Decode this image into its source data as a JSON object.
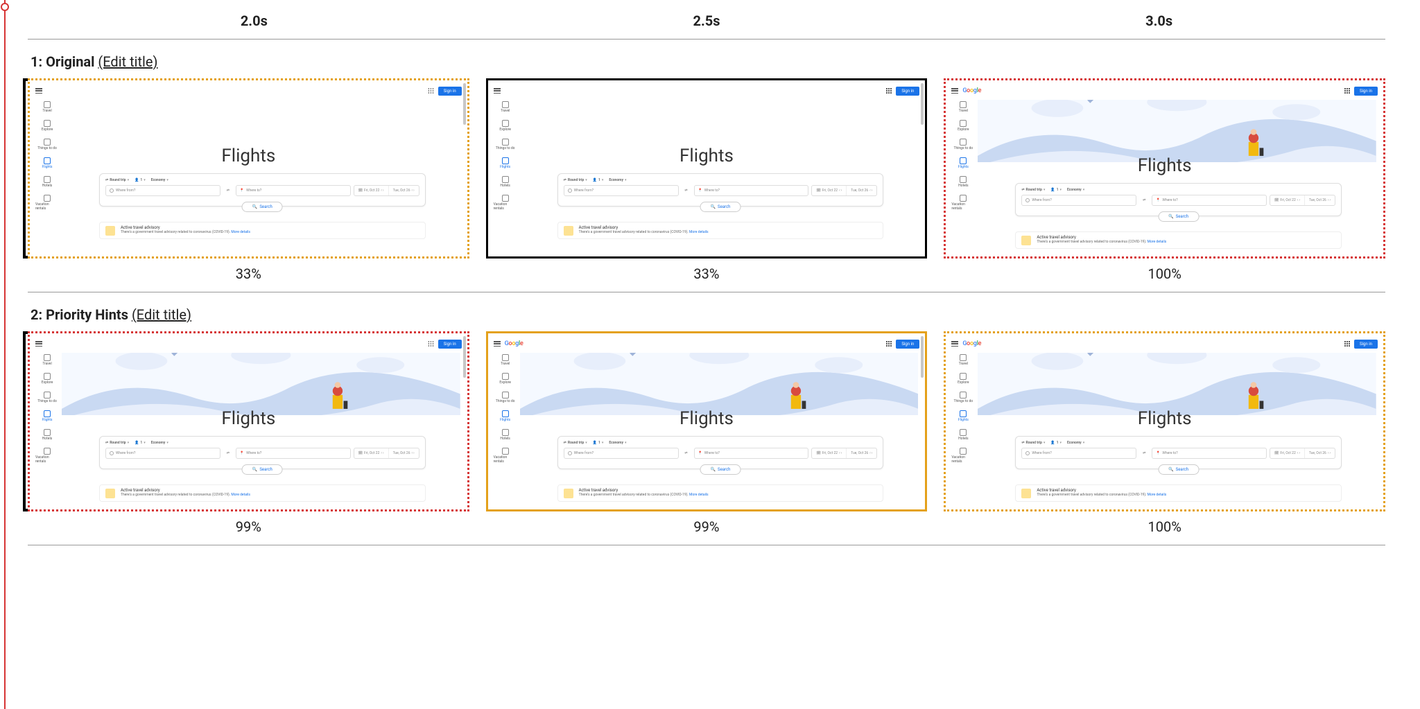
{
  "time_headers": [
    "2.0s",
    "2.5s",
    "3.0s"
  ],
  "sections": [
    {
      "index": "1",
      "name": "Original",
      "edit_label": "(Edit title)",
      "frames": [
        {
          "pct": "33%",
          "border": "border-dotted-yellow",
          "bracket": true,
          "hero": false,
          "logo": false,
          "scrollbar": true
        },
        {
          "pct": "33%",
          "border": "border-solid-black",
          "bracket": false,
          "hero": false,
          "logo": false,
          "scrollbar": true
        },
        {
          "pct": "100%",
          "border": "border-dotted-red",
          "bracket": false,
          "hero": true,
          "logo": true,
          "scrollbar": false
        }
      ]
    },
    {
      "index": "2",
      "name": "Priority Hints",
      "edit_label": "(Edit title)",
      "frames": [
        {
          "pct": "99%",
          "border": "border-dotted-red",
          "bracket": true,
          "hero": true,
          "logo": false,
          "scrollbar": true
        },
        {
          "pct": "99%",
          "border": "border-solid-yellow",
          "bracket": false,
          "hero": true,
          "logo": true,
          "scrollbar": true
        },
        {
          "pct": "100%",
          "border": "border-dotted-yellow",
          "bracket": false,
          "hero": true,
          "logo": true,
          "scrollbar": false
        }
      ]
    }
  ],
  "thumb": {
    "title": "Flights",
    "signin": "Sign in",
    "sidebar": [
      "Travel",
      "Explore",
      "Things to do",
      "Flights",
      "Hotels",
      "Vacation rentals"
    ],
    "sidebar_active_index": 3,
    "trip_type": "Round trip",
    "passengers": "1",
    "cabin": "Economy",
    "from_placeholder": "Where from?",
    "to_placeholder": "Where to?",
    "date1": "Fri, Oct 22",
    "date2": "Tue, Oct 26",
    "search_label": "Search",
    "advisory_title": "Active travel advisory",
    "advisory_body": "There's a government travel advisory related to coronavirus (COVID-19).",
    "advisory_more": "More details"
  }
}
